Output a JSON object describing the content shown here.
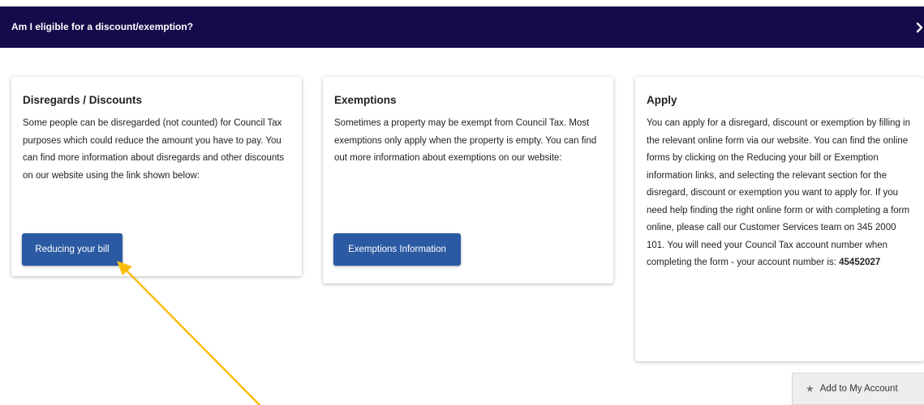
{
  "header": {
    "title": "Am I eligible for a discount/exemption?",
    "expand_icon": "chevron-right-icon"
  },
  "cards": [
    {
      "title": "Disregards / Discounts",
      "text": "Some people can be disregarded (not counted) for Council Tax purposes which could reduce the amount you have to pay. You can find more information about disregards and other discounts on our website using the link shown below:",
      "button_label": "Reducing your bill"
    },
    {
      "title": "Exemptions",
      "text": "Sometimes a property may be exempt from Council Tax. Most exemptions only apply when the property is empty. You can find out more information about exemptions on our website:",
      "button_label": "Exemptions Information"
    },
    {
      "title": "Apply",
      "text": "You can apply for a disregard, discount or exemption by filling in the relevant online form via our website. You can find the online forms by clicking on the Reducing your bill or Exemption information links, and selecting the relevant section for the disregard, discount or exemption you want to apply for. If you need help finding the right online form or with completing a form online, please call our Customer Services team on 345 2000 101. You will need your Council Tax account number when completing the form - your account number is:",
      "account_number": "45452027"
    }
  ],
  "actions": {
    "add_account_label": "Add to My Account",
    "add_account_icon": "star-icon"
  },
  "annotation": {
    "arrow_icon": "pointer-arrow-icon",
    "arrow_color": "#fbbd0b"
  },
  "colors": {
    "header_bg": "#150a4a",
    "button_bg": "#2b5aa3"
  }
}
